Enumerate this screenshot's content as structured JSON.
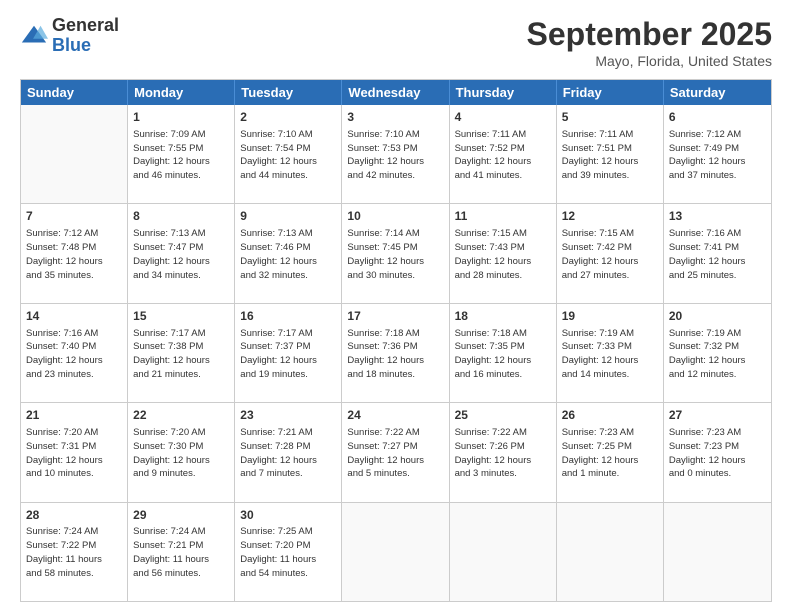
{
  "logo": {
    "general": "General",
    "blue": "Blue"
  },
  "title": {
    "month": "September 2025",
    "location": "Mayo, Florida, United States"
  },
  "header_days": [
    "Sunday",
    "Monday",
    "Tuesday",
    "Wednesday",
    "Thursday",
    "Friday",
    "Saturday"
  ],
  "weeks": [
    [
      {
        "day": "",
        "info": ""
      },
      {
        "day": "1",
        "info": "Sunrise: 7:09 AM\nSunset: 7:55 PM\nDaylight: 12 hours\nand 46 minutes."
      },
      {
        "day": "2",
        "info": "Sunrise: 7:10 AM\nSunset: 7:54 PM\nDaylight: 12 hours\nand 44 minutes."
      },
      {
        "day": "3",
        "info": "Sunrise: 7:10 AM\nSunset: 7:53 PM\nDaylight: 12 hours\nand 42 minutes."
      },
      {
        "day": "4",
        "info": "Sunrise: 7:11 AM\nSunset: 7:52 PM\nDaylight: 12 hours\nand 41 minutes."
      },
      {
        "day": "5",
        "info": "Sunrise: 7:11 AM\nSunset: 7:51 PM\nDaylight: 12 hours\nand 39 minutes."
      },
      {
        "day": "6",
        "info": "Sunrise: 7:12 AM\nSunset: 7:49 PM\nDaylight: 12 hours\nand 37 minutes."
      }
    ],
    [
      {
        "day": "7",
        "info": "Sunrise: 7:12 AM\nSunset: 7:48 PM\nDaylight: 12 hours\nand 35 minutes."
      },
      {
        "day": "8",
        "info": "Sunrise: 7:13 AM\nSunset: 7:47 PM\nDaylight: 12 hours\nand 34 minutes."
      },
      {
        "day": "9",
        "info": "Sunrise: 7:13 AM\nSunset: 7:46 PM\nDaylight: 12 hours\nand 32 minutes."
      },
      {
        "day": "10",
        "info": "Sunrise: 7:14 AM\nSunset: 7:45 PM\nDaylight: 12 hours\nand 30 minutes."
      },
      {
        "day": "11",
        "info": "Sunrise: 7:15 AM\nSunset: 7:43 PM\nDaylight: 12 hours\nand 28 minutes."
      },
      {
        "day": "12",
        "info": "Sunrise: 7:15 AM\nSunset: 7:42 PM\nDaylight: 12 hours\nand 27 minutes."
      },
      {
        "day": "13",
        "info": "Sunrise: 7:16 AM\nSunset: 7:41 PM\nDaylight: 12 hours\nand 25 minutes."
      }
    ],
    [
      {
        "day": "14",
        "info": "Sunrise: 7:16 AM\nSunset: 7:40 PM\nDaylight: 12 hours\nand 23 minutes."
      },
      {
        "day": "15",
        "info": "Sunrise: 7:17 AM\nSunset: 7:38 PM\nDaylight: 12 hours\nand 21 minutes."
      },
      {
        "day": "16",
        "info": "Sunrise: 7:17 AM\nSunset: 7:37 PM\nDaylight: 12 hours\nand 19 minutes."
      },
      {
        "day": "17",
        "info": "Sunrise: 7:18 AM\nSunset: 7:36 PM\nDaylight: 12 hours\nand 18 minutes."
      },
      {
        "day": "18",
        "info": "Sunrise: 7:18 AM\nSunset: 7:35 PM\nDaylight: 12 hours\nand 16 minutes."
      },
      {
        "day": "19",
        "info": "Sunrise: 7:19 AM\nSunset: 7:33 PM\nDaylight: 12 hours\nand 14 minutes."
      },
      {
        "day": "20",
        "info": "Sunrise: 7:19 AM\nSunset: 7:32 PM\nDaylight: 12 hours\nand 12 minutes."
      }
    ],
    [
      {
        "day": "21",
        "info": "Sunrise: 7:20 AM\nSunset: 7:31 PM\nDaylight: 12 hours\nand 10 minutes."
      },
      {
        "day": "22",
        "info": "Sunrise: 7:20 AM\nSunset: 7:30 PM\nDaylight: 12 hours\nand 9 minutes."
      },
      {
        "day": "23",
        "info": "Sunrise: 7:21 AM\nSunset: 7:28 PM\nDaylight: 12 hours\nand 7 minutes."
      },
      {
        "day": "24",
        "info": "Sunrise: 7:22 AM\nSunset: 7:27 PM\nDaylight: 12 hours\nand 5 minutes."
      },
      {
        "day": "25",
        "info": "Sunrise: 7:22 AM\nSunset: 7:26 PM\nDaylight: 12 hours\nand 3 minutes."
      },
      {
        "day": "26",
        "info": "Sunrise: 7:23 AM\nSunset: 7:25 PM\nDaylight: 12 hours\nand 1 minute."
      },
      {
        "day": "27",
        "info": "Sunrise: 7:23 AM\nSunset: 7:23 PM\nDaylight: 12 hours\nand 0 minutes."
      }
    ],
    [
      {
        "day": "28",
        "info": "Sunrise: 7:24 AM\nSunset: 7:22 PM\nDaylight: 11 hours\nand 58 minutes."
      },
      {
        "day": "29",
        "info": "Sunrise: 7:24 AM\nSunset: 7:21 PM\nDaylight: 11 hours\nand 56 minutes."
      },
      {
        "day": "30",
        "info": "Sunrise: 7:25 AM\nSunset: 7:20 PM\nDaylight: 11 hours\nand 54 minutes."
      },
      {
        "day": "",
        "info": ""
      },
      {
        "day": "",
        "info": ""
      },
      {
        "day": "",
        "info": ""
      },
      {
        "day": "",
        "info": ""
      }
    ]
  ]
}
